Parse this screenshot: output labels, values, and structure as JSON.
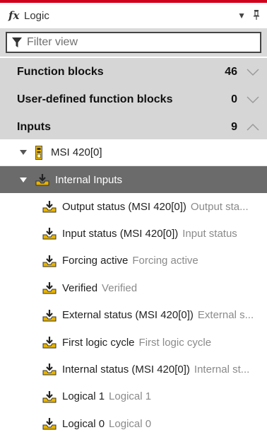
{
  "window": {
    "title": "Logic",
    "fx_symbol": "fx"
  },
  "filter": {
    "placeholder": "Filter view"
  },
  "categories": [
    {
      "label": "Function blocks",
      "count": "46",
      "expanded": false
    },
    {
      "label": "User-defined function blocks",
      "count": "0",
      "expanded": false
    },
    {
      "label": "Inputs",
      "count": "9",
      "expanded": true
    }
  ],
  "tree": {
    "device": {
      "label": "MSI 420[0]"
    },
    "group": {
      "label": "Internal Inputs"
    },
    "items": [
      {
        "label": "Output status (MSI 420[0])",
        "sub": "Output sta..."
      },
      {
        "label": "Input status (MSI 420[0])",
        "sub": "Input status"
      },
      {
        "label": "Forcing active",
        "sub": "Forcing active"
      },
      {
        "label": "Verified",
        "sub": "Verified"
      },
      {
        "label": "External status (MSI 420[0])",
        "sub": "External s..."
      },
      {
        "label": "First logic cycle",
        "sub": "First logic cycle"
      },
      {
        "label": "Internal status (MSI 420[0])",
        "sub": "Internal st..."
      },
      {
        "label": "Logical 1",
        "sub": "Logical 1"
      },
      {
        "label": "Logical 0",
        "sub": "Logical 0"
      }
    ]
  },
  "colors": {
    "accent": "#d0021b",
    "category_bg": "#d6d6d6",
    "selected_group_bg": "#6b6b6b",
    "input_icon": "#e8b400"
  }
}
